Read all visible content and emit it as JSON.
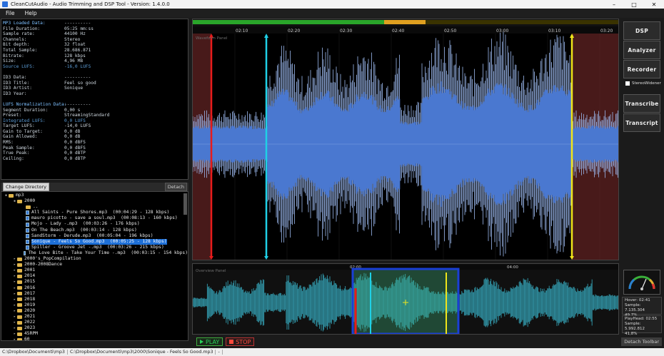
{
  "window": {
    "title": "CleanCutAudio - Audio Trimming and DSP Tool - Version: 1.4.0.0",
    "controls": [
      "–",
      "□",
      "✕"
    ]
  },
  "menu": [
    "File",
    "Help"
  ],
  "info": {
    "rows": [
      {
        "k": "MP3 Loaded Data:",
        "v": "----------",
        "type": "head"
      },
      {
        "k": "File Duration:",
        "v": "05:25 mm:ss"
      },
      {
        "k": "Sample rate:",
        "v": "44100 Hz"
      },
      {
        "k": "Channels:",
        "v": "Stereo"
      },
      {
        "k": "Bit depth:",
        "v": "32 float"
      },
      {
        "k": "Total Sample:",
        "v": "28.686.871"
      },
      {
        "k": "Bitrate:",
        "v": "128 kbps"
      },
      {
        "k": "Size:",
        "v": "4,96 MB"
      },
      {
        "k": "Source LUFS:",
        "v": "-16,0 LUFS",
        "type": "blue"
      },
      {
        "k": "",
        "v": "",
        "type": "gap"
      },
      {
        "k": "ID3 Data:",
        "v": "----------"
      },
      {
        "k": "ID3 Title:",
        "v": "Feel so good"
      },
      {
        "k": "ID3 Artist:",
        "v": "Sonique"
      },
      {
        "k": "ID3 Year:",
        "v": ""
      },
      {
        "k": "",
        "v": "",
        "type": "gap"
      },
      {
        "k": "LUFS Normalization Data:",
        "v": "----------",
        "type": "head"
      },
      {
        "k": "Segment Duration:",
        "v": "0,00 s"
      },
      {
        "k": "Preset:",
        "v": "StreamingStandard"
      },
      {
        "k": "Integrated LUFS:",
        "v": "0,0 LUFS",
        "type": "blue"
      },
      {
        "k": "Target LUFS:",
        "v": "-14,0 LUFS"
      },
      {
        "k": "Gain to Target:",
        "v": "0,0 dB"
      },
      {
        "k": "Gain Allowed:",
        "v": "0,0 dB"
      },
      {
        "k": "RMS:",
        "v": "0,0 dBFS"
      },
      {
        "k": "Peak Sample:",
        "v": "0,0 dBFS"
      },
      {
        "k": "True Peak:",
        "v": "0,0 dBTP"
      },
      {
        "k": "Ceiling:",
        "v": "0,0 dBTP"
      }
    ]
  },
  "dirbar": {
    "change": "Change Directory",
    "detach": "Detach"
  },
  "tree": [
    {
      "depth": 0,
      "exp": "▪",
      "kind": "folder",
      "label": "mp3"
    },
    {
      "depth": 1,
      "exp": "▪",
      "kind": "folder",
      "label": "2000"
    },
    {
      "depth": 2,
      "exp": "",
      "kind": "folder",
      "label": ".."
    },
    {
      "depth": 2,
      "exp": "",
      "kind": "mp3",
      "label": "All Saints - Pure Shores.mp3  (00:04:29 - 128 kbps)"
    },
    {
      "depth": 2,
      "exp": "",
      "kind": "mp3",
      "label": "mauro picotto - save a soul.mp3  (00:08:13 - 160 kbps)"
    },
    {
      "depth": 2,
      "exp": "",
      "kind": "mp3",
      "label": "Mojo - Lady -.mp3  (00:03:26 - 176 kbps)"
    },
    {
      "depth": 2,
      "exp": "",
      "kind": "mp3",
      "label": "On The Beach.mp3  (00:03:14 - 128 kbps)"
    },
    {
      "depth": 2,
      "exp": "",
      "kind": "mp3",
      "label": "SandStorm - Derude.mp3  (00:05:04 - 196 kbps)"
    },
    {
      "depth": 2,
      "exp": "",
      "kind": "mp3",
      "label": "Sonique - Feels So Good.mp3  (00:05:25 - 128 kbps)",
      "selected": true
    },
    {
      "depth": 2,
      "exp": "",
      "kind": "mp3",
      "label": "Spiller - Groove Jet -.mp3  (00:03:26 - 215 kbps)"
    },
    {
      "depth": 2,
      "exp": "",
      "kind": "mp3",
      "label": "The Love Bite - Take Your Time -.mp3  (00:03:15 - 154 kbps)"
    },
    {
      "depth": 1,
      "exp": "▸",
      "kind": "folder",
      "label": "2000's_PopCompilation"
    },
    {
      "depth": 1,
      "exp": "▸",
      "kind": "folder",
      "label": "2000-2008Dance"
    },
    {
      "depth": 1,
      "exp": "▸",
      "kind": "folder",
      "label": "2001"
    },
    {
      "depth": 1,
      "exp": "▸",
      "kind": "folder",
      "label": "2014"
    },
    {
      "depth": 1,
      "exp": "▸",
      "kind": "folder",
      "label": "2015"
    },
    {
      "depth": 1,
      "exp": "▸",
      "kind": "folder",
      "label": "2016"
    },
    {
      "depth": 1,
      "exp": "▸",
      "kind": "folder",
      "label": "2017"
    },
    {
      "depth": 1,
      "exp": "▸",
      "kind": "folder",
      "label": "2018"
    },
    {
      "depth": 1,
      "exp": "▸",
      "kind": "folder",
      "label": "2019"
    },
    {
      "depth": 1,
      "exp": "▸",
      "kind": "folder",
      "label": "2020"
    },
    {
      "depth": 1,
      "exp": "▸",
      "kind": "folder",
      "label": "2021"
    },
    {
      "depth": 1,
      "exp": "▸",
      "kind": "folder",
      "label": "2022"
    },
    {
      "depth": 1,
      "exp": "▸",
      "kind": "folder",
      "label": "2023"
    },
    {
      "depth": 1,
      "exp": "▸",
      "kind": "folder",
      "label": "45RPM"
    },
    {
      "depth": 1,
      "exp": "▸",
      "kind": "folder",
      "label": "60"
    }
  ],
  "waveform": {
    "panel_label": "Waveform Panel",
    "time_ticks": [
      "02:10",
      "02:20",
      "02:30",
      "02:40",
      "02:50",
      "03:00",
      "03:10",
      "03:20"
    ],
    "colors": {
      "wave": "#4a78d0",
      "wave_light": "#9bb8ee",
      "start": "#e81b1b",
      "loop_a": "#1fd0e6",
      "loop_b": "#f0e51a",
      "outside": "#5a2020"
    }
  },
  "overview": {
    "panel_label": "Overview Panel",
    "time_ticks": [
      "02:00",
      "04:00"
    ],
    "colors": {
      "wave": "#2f8fa0",
      "region": "#1a3fd6",
      "region_fill": "#3fb27a"
    }
  },
  "transport": {
    "play": "PLAY",
    "stop": "STOP",
    "detach": "Detach Toolbar"
  },
  "sidebar": {
    "dsp": "DSP",
    "analyzer": "Analyzer",
    "recorder": "Recorder",
    "stereo": "StereoWidener",
    "transcribe": "Transcribe",
    "transcript": "Transcript"
  },
  "hover": {
    "line1": "Hover: 02:41",
    "line2": "Sample: 7.135.304",
    "line3": "49,7%"
  },
  "playhead": {
    "line1": "PlayHead: 02:55",
    "line2": "Sample: 5.992.812",
    "line3": "41,8%"
  },
  "status": {
    "path1": "C:\\Dropbox\\Documenti\\mp3",
    "path2": "C:\\Dropbox\\Documenti\\mp3\\2000\\Sonique - Feels So Good.mp3",
    "sep": "-"
  }
}
